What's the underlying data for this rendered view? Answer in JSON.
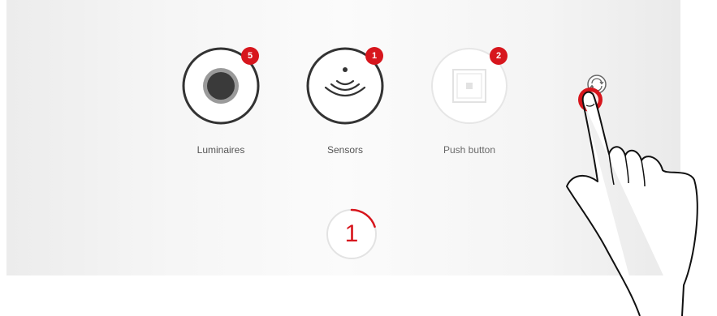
{
  "devices": [
    {
      "label": "Luminaires",
      "count": "5"
    },
    {
      "label": "Sensors",
      "count": "1"
    },
    {
      "label": "Push button",
      "count": "2"
    }
  ],
  "counter": {
    "value": "1",
    "progress_fraction": 0.2
  },
  "colors": {
    "accent": "#d7161d",
    "ring": "#333333",
    "ring_faded": "#e4e4e4",
    "label": "#555555"
  },
  "icons": {
    "luminaire": "luminaire-icon",
    "sensor": "sensor-icon",
    "push_button": "push-button-icon",
    "rotate": "rotate-icon",
    "hand": "pointing-hand-icon"
  }
}
